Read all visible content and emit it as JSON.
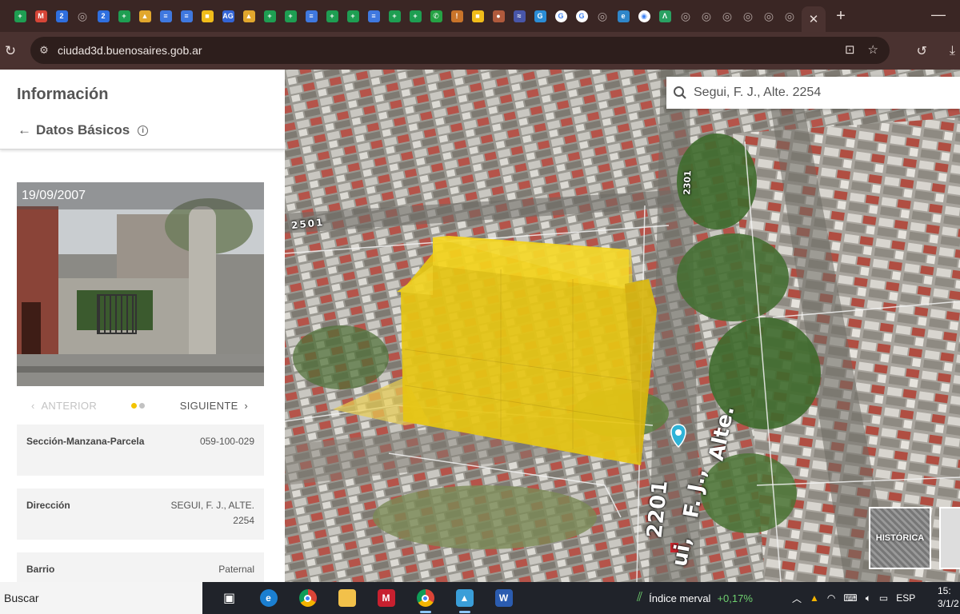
{
  "browser": {
    "url": "ciudad3d.buenosaires.gob.ar",
    "tab_favicons": [
      {
        "name": "sheets-icon",
        "color": "#1e9e52",
        "glyph": "+"
      },
      {
        "name": "gmail-icon",
        "color": "#d64537",
        "glyph": "M"
      },
      {
        "name": "app-icon",
        "color": "#2f6fdf",
        "glyph": "2"
      },
      {
        "name": "globe-icon",
        "color": "#7a6a68",
        "glyph": "◎"
      },
      {
        "name": "app-icon",
        "color": "#2f6fdf",
        "glyph": "2"
      },
      {
        "name": "sheets-icon",
        "color": "#1e9e52",
        "glyph": "+"
      },
      {
        "name": "drive-icon",
        "color": "#e1a72d",
        "glyph": "▲"
      },
      {
        "name": "docs-icon",
        "color": "#3f78df",
        "glyph": "≡"
      },
      {
        "name": "docs-icon",
        "color": "#3f78df",
        "glyph": "≡"
      },
      {
        "name": "keep-icon",
        "color": "#f1bc1a",
        "glyph": "■"
      },
      {
        "name": "ag-icon",
        "color": "#3364d6",
        "glyph": "AG"
      },
      {
        "name": "drive-icon",
        "color": "#e1a72d",
        "glyph": "▲"
      },
      {
        "name": "sheets-icon",
        "color": "#1e9e52",
        "glyph": "+"
      },
      {
        "name": "sheets-icon",
        "color": "#1e9e52",
        "glyph": "+"
      },
      {
        "name": "docs-icon",
        "color": "#3f78df",
        "glyph": "≡"
      },
      {
        "name": "sheets-icon",
        "color": "#1e9e52",
        "glyph": "+"
      },
      {
        "name": "sheets-icon",
        "color": "#1e9e52",
        "glyph": "+"
      },
      {
        "name": "docs-icon",
        "color": "#3f78df",
        "glyph": "≡"
      },
      {
        "name": "sheets-icon",
        "color": "#1e9e52",
        "glyph": "+"
      },
      {
        "name": "sheets-icon",
        "color": "#1e9e52",
        "glyph": "+"
      },
      {
        "name": "whatsapp-icon",
        "color": "#25a244",
        "glyph": "✆"
      },
      {
        "name": "pin-icon",
        "color": "#c9742a",
        "glyph": "!"
      },
      {
        "name": "keep-icon",
        "color": "#f1bc1a",
        "glyph": "■"
      },
      {
        "name": "site-icon",
        "color": "#b05a3c",
        "glyph": "●"
      },
      {
        "name": "site-icon",
        "color": "#4856a8",
        "glyph": "≈"
      },
      {
        "name": "g-icon",
        "color": "#2b8dd6",
        "glyph": "G"
      },
      {
        "name": "google-icon",
        "color": "#ffffff",
        "glyph": "G"
      },
      {
        "name": "google-icon",
        "color": "#ffffff",
        "glyph": "G"
      },
      {
        "name": "globe-icon",
        "color": "#7a6a68",
        "glyph": "◎"
      },
      {
        "name": "edge-icon",
        "color": "#2f86c9",
        "glyph": "e"
      },
      {
        "name": "chrome-icon",
        "color": "#ffffff",
        "glyph": "◉"
      },
      {
        "name": "site-icon",
        "color": "#2aa162",
        "glyph": "Λ"
      },
      {
        "name": "globe-icon",
        "color": "#7a6a68",
        "glyph": "◎"
      },
      {
        "name": "globe-icon",
        "color": "#7a6a68",
        "glyph": "◎"
      },
      {
        "name": "globe-icon",
        "color": "#7a6a68",
        "glyph": "◎"
      },
      {
        "name": "globe-icon",
        "color": "#7a6a68",
        "glyph": "◎"
      },
      {
        "name": "globe-icon",
        "color": "#7a6a68",
        "glyph": "◎"
      },
      {
        "name": "globe-icon",
        "color": "#7a6a68",
        "glyph": "◎"
      }
    ]
  },
  "panel": {
    "title": "Información",
    "subtitle": "Datos Básicos",
    "photo_date": "19/09/2007",
    "prev_label": "ANTERIOR",
    "next_label": "SIGUIENTE",
    "active_dot_color": "#f3c400",
    "rows": [
      {
        "label": "Sección-Manzana-Parcela",
        "value": "059-100-029"
      },
      {
        "label": "Dirección",
        "value": "SEGUI, F. J., ALTE. 2254"
      },
      {
        "label": "Barrio",
        "value": "Paternal"
      }
    ]
  },
  "map": {
    "search_value": "Segui, F. J., Alte. 2254",
    "historica_label": "HISTÓRICA",
    "street_labels": [
      "2501",
      "2301",
      "2201",
      "Alte.",
      "F. J.,",
      "ui,"
    ],
    "building_color": "#f4d21a"
  },
  "taskbar": {
    "search_label": "Buscar",
    "merval_label": "Índice merval",
    "merval_value": "+0,17%",
    "language": "ESP",
    "time": "15:",
    "date": "3/1/2"
  }
}
